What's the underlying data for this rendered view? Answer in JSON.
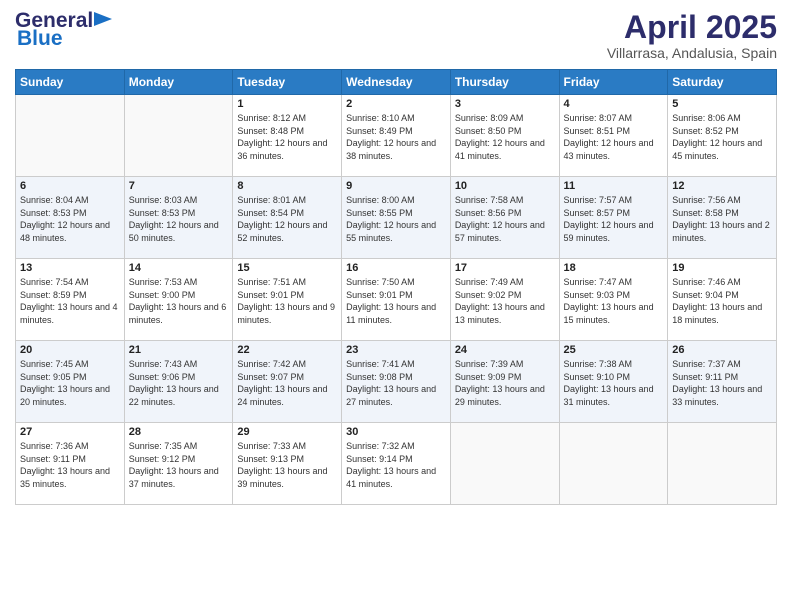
{
  "header": {
    "logo_line1": "General",
    "logo_line2": "Blue",
    "title": "April 2025",
    "subtitle": "Villarrasa, Andalusia, Spain"
  },
  "days_of_week": [
    "Sunday",
    "Monday",
    "Tuesday",
    "Wednesday",
    "Thursday",
    "Friday",
    "Saturday"
  ],
  "weeks": [
    [
      {
        "day": "",
        "sunrise": "",
        "sunset": "",
        "daylight": ""
      },
      {
        "day": "",
        "sunrise": "",
        "sunset": "",
        "daylight": ""
      },
      {
        "day": "1",
        "sunrise": "Sunrise: 8:12 AM",
        "sunset": "Sunset: 8:48 PM",
        "daylight": "Daylight: 12 hours and 36 minutes."
      },
      {
        "day": "2",
        "sunrise": "Sunrise: 8:10 AM",
        "sunset": "Sunset: 8:49 PM",
        "daylight": "Daylight: 12 hours and 38 minutes."
      },
      {
        "day": "3",
        "sunrise": "Sunrise: 8:09 AM",
        "sunset": "Sunset: 8:50 PM",
        "daylight": "Daylight: 12 hours and 41 minutes."
      },
      {
        "day": "4",
        "sunrise": "Sunrise: 8:07 AM",
        "sunset": "Sunset: 8:51 PM",
        "daylight": "Daylight: 12 hours and 43 minutes."
      },
      {
        "day": "5",
        "sunrise": "Sunrise: 8:06 AM",
        "sunset": "Sunset: 8:52 PM",
        "daylight": "Daylight: 12 hours and 45 minutes."
      }
    ],
    [
      {
        "day": "6",
        "sunrise": "Sunrise: 8:04 AM",
        "sunset": "Sunset: 8:53 PM",
        "daylight": "Daylight: 12 hours and 48 minutes."
      },
      {
        "day": "7",
        "sunrise": "Sunrise: 8:03 AM",
        "sunset": "Sunset: 8:53 PM",
        "daylight": "Daylight: 12 hours and 50 minutes."
      },
      {
        "day": "8",
        "sunrise": "Sunrise: 8:01 AM",
        "sunset": "Sunset: 8:54 PM",
        "daylight": "Daylight: 12 hours and 52 minutes."
      },
      {
        "day": "9",
        "sunrise": "Sunrise: 8:00 AM",
        "sunset": "Sunset: 8:55 PM",
        "daylight": "Daylight: 12 hours and 55 minutes."
      },
      {
        "day": "10",
        "sunrise": "Sunrise: 7:58 AM",
        "sunset": "Sunset: 8:56 PM",
        "daylight": "Daylight: 12 hours and 57 minutes."
      },
      {
        "day": "11",
        "sunrise": "Sunrise: 7:57 AM",
        "sunset": "Sunset: 8:57 PM",
        "daylight": "Daylight: 12 hours and 59 minutes."
      },
      {
        "day": "12",
        "sunrise": "Sunrise: 7:56 AM",
        "sunset": "Sunset: 8:58 PM",
        "daylight": "Daylight: 13 hours and 2 minutes."
      }
    ],
    [
      {
        "day": "13",
        "sunrise": "Sunrise: 7:54 AM",
        "sunset": "Sunset: 8:59 PM",
        "daylight": "Daylight: 13 hours and 4 minutes."
      },
      {
        "day": "14",
        "sunrise": "Sunrise: 7:53 AM",
        "sunset": "Sunset: 9:00 PM",
        "daylight": "Daylight: 13 hours and 6 minutes."
      },
      {
        "day": "15",
        "sunrise": "Sunrise: 7:51 AM",
        "sunset": "Sunset: 9:01 PM",
        "daylight": "Daylight: 13 hours and 9 minutes."
      },
      {
        "day": "16",
        "sunrise": "Sunrise: 7:50 AM",
        "sunset": "Sunset: 9:01 PM",
        "daylight": "Daylight: 13 hours and 11 minutes."
      },
      {
        "day": "17",
        "sunrise": "Sunrise: 7:49 AM",
        "sunset": "Sunset: 9:02 PM",
        "daylight": "Daylight: 13 hours and 13 minutes."
      },
      {
        "day": "18",
        "sunrise": "Sunrise: 7:47 AM",
        "sunset": "Sunset: 9:03 PM",
        "daylight": "Daylight: 13 hours and 15 minutes."
      },
      {
        "day": "19",
        "sunrise": "Sunrise: 7:46 AM",
        "sunset": "Sunset: 9:04 PM",
        "daylight": "Daylight: 13 hours and 18 minutes."
      }
    ],
    [
      {
        "day": "20",
        "sunrise": "Sunrise: 7:45 AM",
        "sunset": "Sunset: 9:05 PM",
        "daylight": "Daylight: 13 hours and 20 minutes."
      },
      {
        "day": "21",
        "sunrise": "Sunrise: 7:43 AM",
        "sunset": "Sunset: 9:06 PM",
        "daylight": "Daylight: 13 hours and 22 minutes."
      },
      {
        "day": "22",
        "sunrise": "Sunrise: 7:42 AM",
        "sunset": "Sunset: 9:07 PM",
        "daylight": "Daylight: 13 hours and 24 minutes."
      },
      {
        "day": "23",
        "sunrise": "Sunrise: 7:41 AM",
        "sunset": "Sunset: 9:08 PM",
        "daylight": "Daylight: 13 hours and 27 minutes."
      },
      {
        "day": "24",
        "sunrise": "Sunrise: 7:39 AM",
        "sunset": "Sunset: 9:09 PM",
        "daylight": "Daylight: 13 hours and 29 minutes."
      },
      {
        "day": "25",
        "sunrise": "Sunrise: 7:38 AM",
        "sunset": "Sunset: 9:10 PM",
        "daylight": "Daylight: 13 hours and 31 minutes."
      },
      {
        "day": "26",
        "sunrise": "Sunrise: 7:37 AM",
        "sunset": "Sunset: 9:11 PM",
        "daylight": "Daylight: 13 hours and 33 minutes."
      }
    ],
    [
      {
        "day": "27",
        "sunrise": "Sunrise: 7:36 AM",
        "sunset": "Sunset: 9:11 PM",
        "daylight": "Daylight: 13 hours and 35 minutes."
      },
      {
        "day": "28",
        "sunrise": "Sunrise: 7:35 AM",
        "sunset": "Sunset: 9:12 PM",
        "daylight": "Daylight: 13 hours and 37 minutes."
      },
      {
        "day": "29",
        "sunrise": "Sunrise: 7:33 AM",
        "sunset": "Sunset: 9:13 PM",
        "daylight": "Daylight: 13 hours and 39 minutes."
      },
      {
        "day": "30",
        "sunrise": "Sunrise: 7:32 AM",
        "sunset": "Sunset: 9:14 PM",
        "daylight": "Daylight: 13 hours and 41 minutes."
      },
      {
        "day": "",
        "sunrise": "",
        "sunset": "",
        "daylight": ""
      },
      {
        "day": "",
        "sunrise": "",
        "sunset": "",
        "daylight": ""
      },
      {
        "day": "",
        "sunrise": "",
        "sunset": "",
        "daylight": ""
      }
    ]
  ]
}
